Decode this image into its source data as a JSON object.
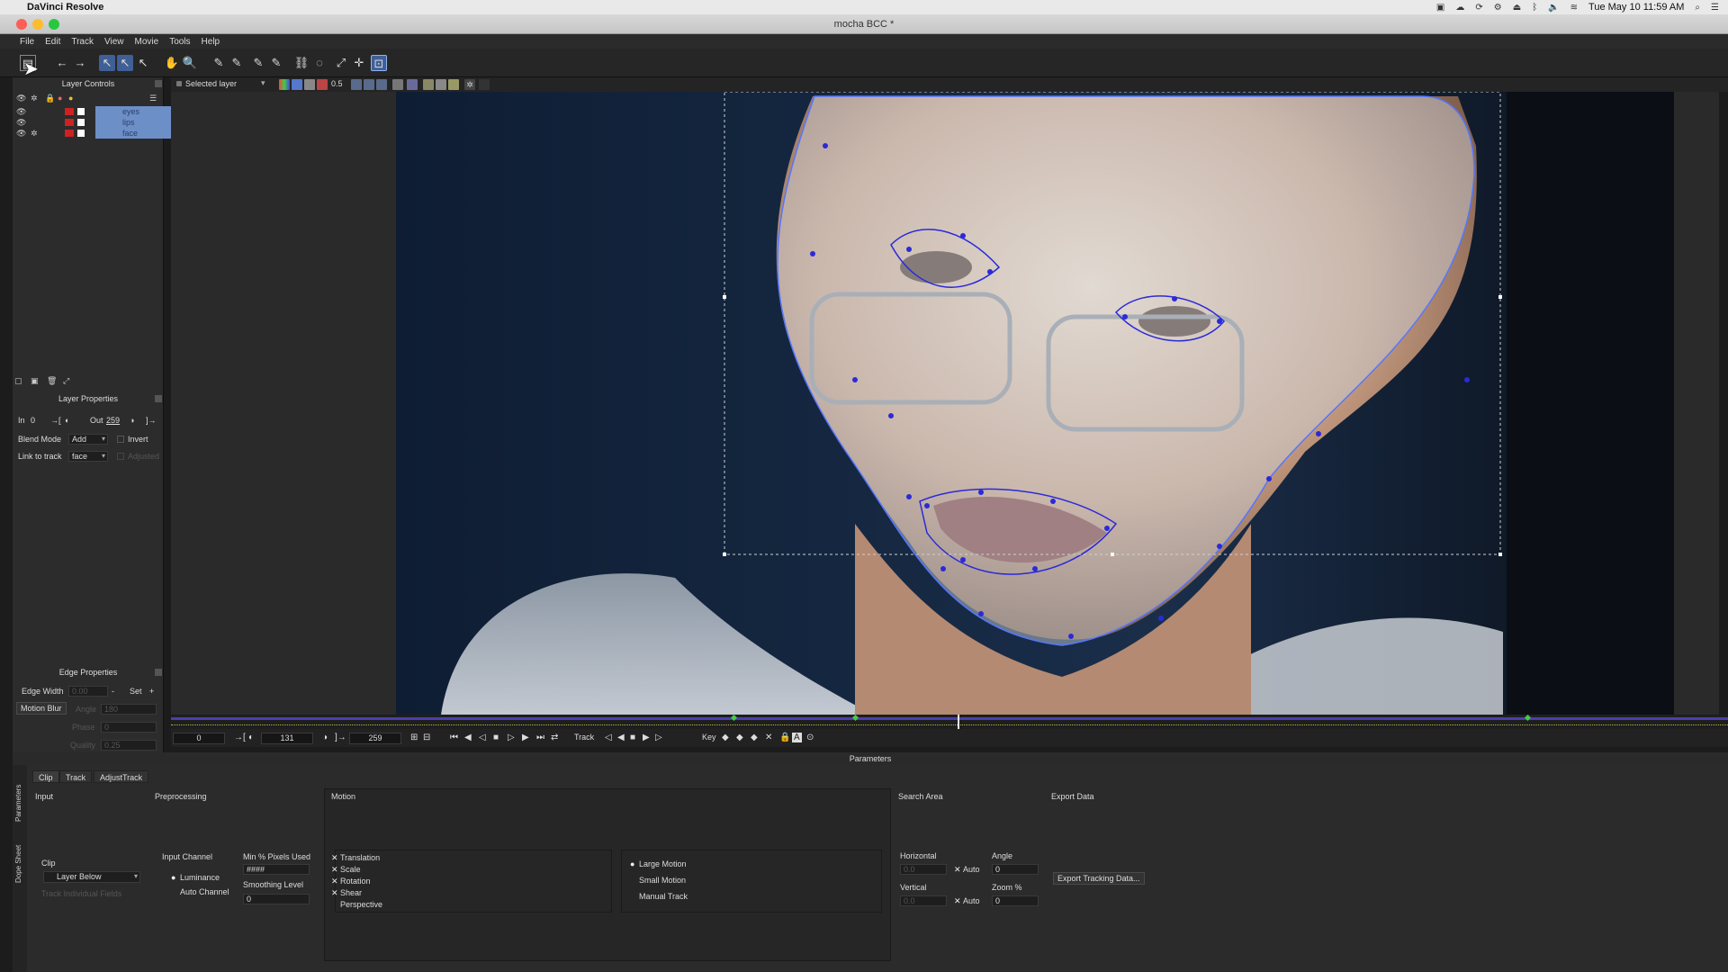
{
  "macbar": {
    "app_name": "DaVinci Resolve",
    "datetime": "Tue May 10  11:59 AM"
  },
  "window": {
    "title": "mocha BCC *"
  },
  "menu": [
    "File",
    "Edit",
    "Track",
    "View",
    "Movie",
    "Tools",
    "Help"
  ],
  "subbar": {
    "layer_select": "Selected layer",
    "opacity": "0.5"
  },
  "layer_controls": {
    "title": "Layer Controls",
    "layers": [
      {
        "name": "eyes",
        "color": "#6d8fc8"
      },
      {
        "name": "lips",
        "color": "#6d8fc8"
      },
      {
        "name": "face",
        "color": "#6d8fc8"
      }
    ]
  },
  "layer_properties": {
    "title": "Layer Properties",
    "in_label": "In",
    "in_value": "0",
    "out_label": "Out",
    "out_value": "259",
    "blend_mode_label": "Blend Mode",
    "blend_mode_value": "Add",
    "invert_label": "Invert",
    "link_to_track_label": "Link to track",
    "link_to_track_value": "face",
    "adjusted_label": "Adjusted"
  },
  "edge_properties": {
    "title": "Edge Properties",
    "edge_width_label": "Edge Width",
    "edge_width_value": "0.00",
    "set_label": "Set",
    "motion_blur_label": "Motion Blur",
    "angle_label": "Angle",
    "angle_value": "180",
    "phase_label": "Phase",
    "phase_value": "0",
    "quality_label": "Quality",
    "quality_value": "0.25"
  },
  "transport": {
    "start_frame": "0",
    "current_frame": "131",
    "end_frame": "259",
    "track_label": "Track",
    "key_label": "Key"
  },
  "timeline": {
    "playhead_fraction": 0.505,
    "keyframe_fractions": [
      0.36,
      0.438,
      0.87
    ]
  },
  "parameters": {
    "title": "Parameters",
    "tabs": [
      "Clip",
      "Track",
      "AdjustTrack"
    ],
    "side_tabs": [
      "Parameters",
      "Dope Sheet"
    ],
    "input": {
      "header": "Input",
      "clip_label": "Clip",
      "clip_value": "Layer Below",
      "track_fields_label": "Track Individual Fields"
    },
    "preprocessing": {
      "header": "Preprocessing",
      "input_channel_label": "Input Channel",
      "luminance_label": "Luminance",
      "auto_channel_label": "Auto Channel",
      "min_pixels_label": "Min % Pixels Used",
      "min_pixels_value": "####",
      "smoothing_label": "Smoothing Level",
      "smoothing_value": "0"
    },
    "motion": {
      "header": "Motion",
      "options": [
        {
          "label": "Translation",
          "checked": true
        },
        {
          "label": "Scale",
          "checked": true
        },
        {
          "label": "Rotation",
          "checked": true
        },
        {
          "label": "Shear",
          "checked": true
        },
        {
          "label": "Perspective",
          "checked": false
        }
      ],
      "modes": [
        {
          "label": "Large Motion",
          "selected": true
        },
        {
          "label": "Small Motion",
          "selected": false
        },
        {
          "label": "Manual Track",
          "selected": false
        }
      ]
    },
    "search_area": {
      "header": "Search Area",
      "horizontal_label": "Horizontal",
      "horizontal_value": "0.0",
      "vertical_label": "Vertical",
      "vertical_value": "0.0",
      "auto_label": "Auto",
      "angle_label": "Angle",
      "angle_value": "0",
      "zoom_label": "Zoom %",
      "zoom_value": "0"
    },
    "export_data": {
      "header": "Export Data",
      "button_label": "Export Tracking Data..."
    }
  },
  "colors": {
    "accent": "#3f5f96",
    "spline": "#2a2ad8",
    "timeline": "#4b3fb0"
  }
}
